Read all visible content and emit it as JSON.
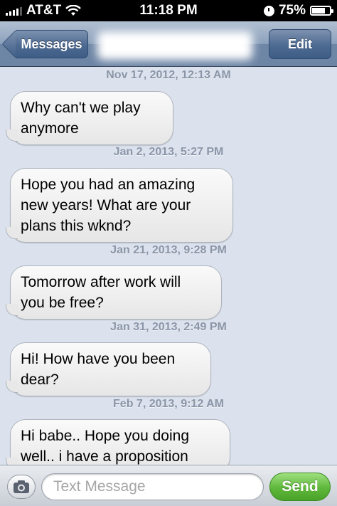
{
  "status_bar": {
    "carrier": "AT&T",
    "time": "11:18 PM",
    "battery_text": "75%",
    "battery_level": 0.75,
    "icons": [
      "signal-icon",
      "wifi-icon",
      "orientation-lock-icon",
      "battery-icon"
    ]
  },
  "nav": {
    "back_label": "Messages",
    "contact_name": "",
    "edit_label": "Edit"
  },
  "messages": [
    {
      "timestamp": "Nov 17, 2012, 12:13 AM",
      "lines": [
        "Why can't we play",
        "anymore"
      ]
    },
    {
      "timestamp": "Jan 2, 2013, 5:27 PM",
      "lines": [
        "Hope you had an amazing",
        "new years! What are your",
        "plans this wknd?"
      ]
    },
    {
      "timestamp": "Jan 21, 2013, 9:28 PM",
      "lines": [
        "Tomorrow after work will",
        "you be free?"
      ]
    },
    {
      "timestamp": "Jan 31, 2013, 2:49 PM",
      "lines": [
        "Hi! How have you been",
        "dear?"
      ]
    },
    {
      "timestamp": "Feb 7, 2013, 9:12 AM",
      "lines": [
        "Hi babe.. Hope you doing",
        "well.. i have a proposition"
      ]
    }
  ],
  "input": {
    "placeholder": "Text Message",
    "send_label": "Send",
    "camera_icon": "camera-icon"
  },
  "colors": {
    "background": "#dbe2ed",
    "send_green": "#5fb73b",
    "nav_blue": "#4d6a91"
  }
}
